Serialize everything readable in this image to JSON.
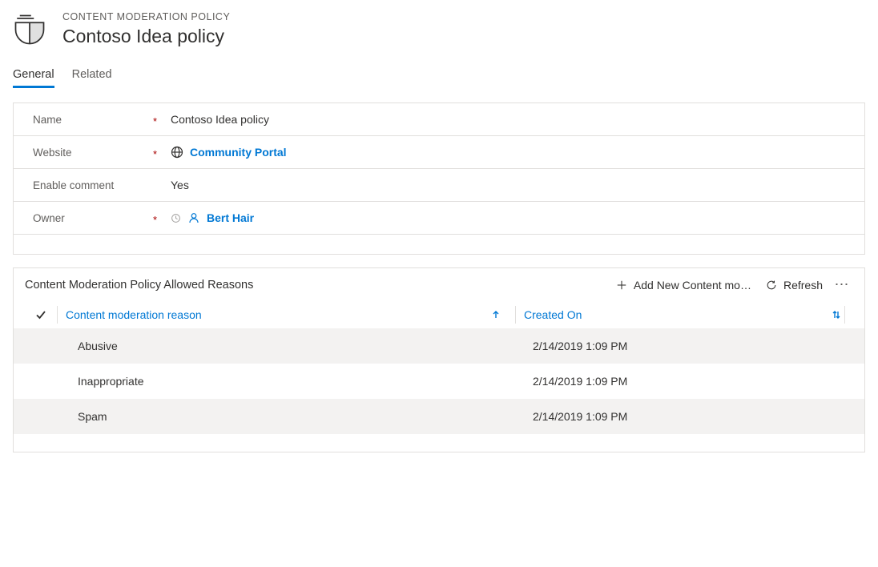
{
  "header": {
    "breadcrumb": "CONTENT MODERATION POLICY",
    "title": "Contoso Idea policy"
  },
  "tabs": {
    "general": "General",
    "related": "Related"
  },
  "form": {
    "name": {
      "label": "Name",
      "value": "Contoso Idea policy"
    },
    "website": {
      "label": "Website",
      "value": "Community Portal"
    },
    "enable_comment": {
      "label": "Enable comment",
      "value": "Yes"
    },
    "owner": {
      "label": "Owner",
      "value": "Bert Hair"
    }
  },
  "subgrid": {
    "title": "Content Moderation Policy Allowed Reasons",
    "add_label": "Add New Content mo…",
    "refresh_label": "Refresh",
    "columns": {
      "reason": "Content moderation reason",
      "created_on": "Created On"
    },
    "rows": [
      {
        "reason": "Abusive",
        "created_on": "2/14/2019 1:09 PM"
      },
      {
        "reason": "Inappropriate",
        "created_on": "2/14/2019 1:09 PM"
      },
      {
        "reason": "Spam",
        "created_on": "2/14/2019 1:09 PM"
      }
    ]
  }
}
